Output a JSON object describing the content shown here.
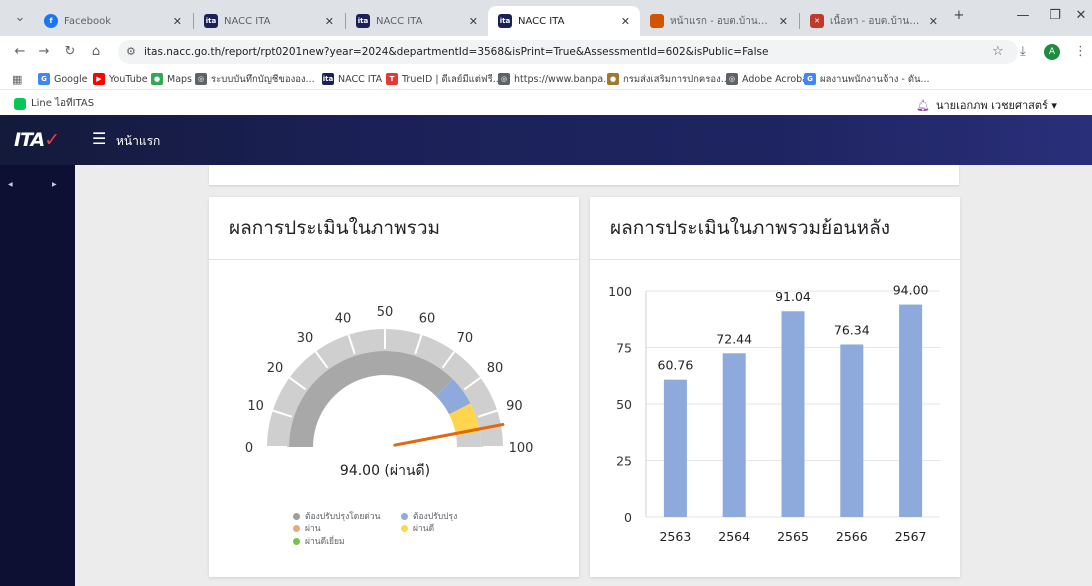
{
  "tabs": [
    {
      "title": "Facebook",
      "icon": "facebook-icon",
      "color": "#1877f2",
      "glyph": "f"
    },
    {
      "title": "NACC ITA",
      "icon": "ita-icon",
      "color": "#1b2157",
      "glyph": "ita"
    },
    {
      "title": "NACC ITA",
      "icon": "ita-icon",
      "color": "#1b2157",
      "glyph": "ita"
    },
    {
      "title": "NACC ITA",
      "icon": "ita-icon",
      "color": "#1b2157",
      "glyph": "ita"
    },
    {
      "title": "หน้าแรก - อบต.บ้านป่า อ.แหง...",
      "icon": "site-icon",
      "color": "#d35400",
      "glyph": "■"
    },
    {
      "title": "เนื้อหา - อบต.บ้านป่า อ.แหง...",
      "icon": "site-icon",
      "color": "#c0392b",
      "glyph": "✕"
    }
  ],
  "address": {
    "url": "itas.nacc.go.th/report/rpt0201new?year=2024&departmentId=3568&isPrint=True&AssessmentId=602&isPublic=False",
    "profile_initial": "A"
  },
  "bookmarks": [
    {
      "label": "Google",
      "icon": "google-icon",
      "color": "#4285f4",
      "glyph": "G"
    },
    {
      "label": "YouTube",
      "icon": "youtube-icon",
      "color": "#ff0000",
      "glyph": "▶"
    },
    {
      "label": "Maps",
      "icon": "maps-icon",
      "color": "#34a853",
      "glyph": "●"
    },
    {
      "label": "ระบบบันทึกบัญชีขององ...",
      "icon": "globe-icon",
      "color": "#5f6368",
      "glyph": "◎"
    },
    {
      "label": "NACC ITA",
      "icon": "ita-icon",
      "color": "#1b2157",
      "glyph": "ita"
    },
    {
      "label": "TrueID | ดีเลย์มีแต่ฟรี...",
      "icon": "trueid-icon",
      "color": "#e53935",
      "glyph": "T"
    },
    {
      "label": "https://www.banpa...",
      "icon": "globe-icon",
      "color": "#5f6368",
      "glyph": "◎"
    },
    {
      "label": "กรมส่งเสริมการปกครอง...",
      "icon": "dla-icon",
      "color": "#9e7a2f",
      "glyph": "●"
    },
    {
      "label": "Adobe Acrobat",
      "icon": "globe-icon",
      "color": "#5f6368",
      "glyph": "◎"
    },
    {
      "label": "ผลงานพนักงานจ้าง - ดัน...",
      "icon": "google-icon",
      "color": "#4285f4",
      "glyph": "G"
    }
  ],
  "subbar": {
    "line_label": "Line ไอทีITAS",
    "user": "นายเอกภพ เวชยศาสตร์ ▾"
  },
  "app": {
    "logo": "ITA",
    "home": "หน้าแรก"
  },
  "cards": {
    "gauge_title": "ผลการประเมินในภาพรวม",
    "history_title": "ผลการประเมินในภาพรวมย้อนหลัง"
  },
  "legend": [
    {
      "label": "ต้องปรับปรุงโดยด่วน",
      "color": "#9e9e9e"
    },
    {
      "label": "ต้องปรับปรุง",
      "color": "#8ea9db"
    },
    {
      "label": "ผ่าน",
      "color": "#e8a87c"
    },
    {
      "label": "ผ่านดี",
      "color": "#ffd54f"
    },
    {
      "label": "ผ่านดีเยี่ยม",
      "color": "#7cc242"
    }
  ],
  "chart_data": [
    {
      "type": "gauge",
      "min": 0,
      "max": 100,
      "ticks": [
        0,
        10,
        20,
        30,
        40,
        50,
        60,
        70,
        80,
        90,
        100
      ],
      "value": 94.0,
      "value_label": "94.00 (ผ่านดี)",
      "bands": [
        {
          "from": 0,
          "to": 75,
          "color": "#a8a8a8"
        },
        {
          "from": 75,
          "to": 85,
          "color": "#8ea9db"
        },
        {
          "from": 85,
          "to": 95,
          "color": "#ffd54f"
        },
        {
          "from": 95,
          "to": 100,
          "color": "#cfcfcf"
        }
      ],
      "needle_color": "#e06a10"
    },
    {
      "type": "bar",
      "categories": [
        "2563",
        "2564",
        "2565",
        "2566",
        "2567"
      ],
      "values": [
        60.76,
        72.44,
        91.04,
        76.34,
        94.0
      ],
      "value_labels": [
        "60.76",
        "72.44",
        "91.04",
        "76.34",
        "94.00"
      ],
      "ylim": [
        0,
        100
      ],
      "yticks": [
        "0",
        "25",
        "50",
        "75",
        "100"
      ],
      "bar_color": "#8ea9db"
    }
  ]
}
